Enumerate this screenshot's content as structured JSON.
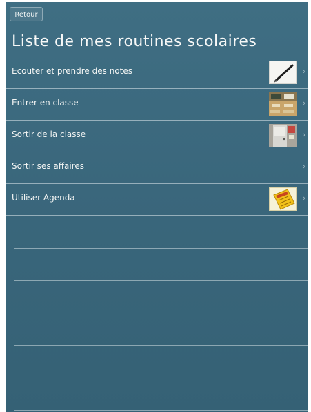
{
  "header": {
    "back_label": "Retour",
    "title": "Liste de mes routines scolaires"
  },
  "routines": [
    {
      "label": "Ecouter et prendre des notes",
      "icon": "pen-icon"
    },
    {
      "label": "Entrer en classe",
      "icon": "classroom-photo-icon"
    },
    {
      "label": "Sortir de la classe",
      "icon": "classroom-door-photo-icon"
    },
    {
      "label": "Sortir ses affaires",
      "icon": ""
    },
    {
      "label": "Utiliser Agenda",
      "icon": "agenda-notebook-icon"
    }
  ],
  "chevron": "›",
  "colors": {
    "board": "#3a677c",
    "text": "#f4f6f4",
    "line": "#e1ebee"
  }
}
